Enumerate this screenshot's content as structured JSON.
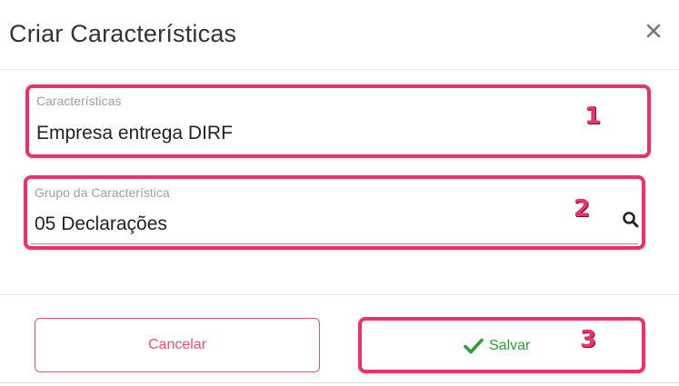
{
  "dialog": {
    "title": "Criar Características",
    "close_icon": "close-icon"
  },
  "fields": [
    {
      "label": "Características",
      "value": "Empresa entrega DIRF",
      "annotation": "1"
    },
    {
      "label": "Grupo da Característica",
      "value": "05 Declarações",
      "annotation": "2",
      "icon": "search-icon"
    }
  ],
  "footer": {
    "cancel_label": "Cancelar",
    "save_label": "Salvar",
    "save_icon": "check-icon",
    "save_annotation": "3"
  },
  "colors": {
    "highlight": "#e8336a",
    "cancel": "#e0526e",
    "save": "#2e9d3c",
    "title": "#333333"
  }
}
